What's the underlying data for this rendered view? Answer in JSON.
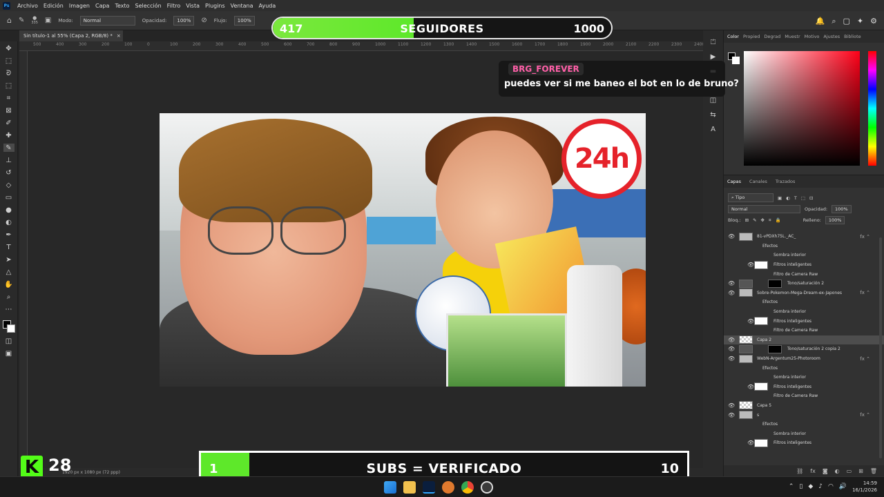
{
  "app": {
    "logo": "Ps",
    "menu": [
      "Archivo",
      "Edición",
      "Imagen",
      "Capa",
      "Texto",
      "Selección",
      "Filtro",
      "Vista",
      "Plugins",
      "Ventana",
      "Ayuda"
    ]
  },
  "options_bar": {
    "brush_size": "335",
    "mode_label": "Modo:",
    "mode_value": "Normal",
    "opacity_label": "Opacidad:",
    "opacity_value": "100%",
    "flow_label": "Flujo:",
    "flow_value": "100%"
  },
  "document_tab": {
    "title": "Sin título-1 al 55% (Capa 2, RGB/8) *",
    "close": "×"
  },
  "ruler_ticks": [
    "500",
    "400",
    "300",
    "200",
    "100",
    "0",
    "100",
    "200",
    "300",
    "400",
    "500",
    "600",
    "700",
    "800",
    "900",
    "1000",
    "1100",
    "1200",
    "1300",
    "1400",
    "1500",
    "1600",
    "1700",
    "1800",
    "1900",
    "2000",
    "2100",
    "2200",
    "2300",
    "2400"
  ],
  "thumbnail": {
    "badge_text": "24h",
    "badge_color": "#e5222a"
  },
  "status_bar": {
    "dimensions": "1920 px x 1080 px (72 ppp)"
  },
  "color_panel": {
    "tabs": [
      "Color",
      "Propied",
      "Degrad",
      "Muestr",
      "Motivo",
      "Ajustes",
      "Bibliote"
    ]
  },
  "layers_panel": {
    "tabs": [
      "Capas",
      "Canales",
      "Trazados"
    ],
    "filter_type": "Tipo",
    "blend_mode": "Normal",
    "opacity_label": "Opacidad:",
    "opacity_value": "100%",
    "lock_label": "Bloq.:",
    "fill_label": "Relleno:",
    "fill_value": "100%",
    "layers": [
      {
        "name": "81-vPDXh75L._AC_",
        "kind": "smart",
        "fx": true
      },
      {
        "name": "Efectos",
        "kind": "sub"
      },
      {
        "name": "Sombra interior",
        "kind": "sub2"
      },
      {
        "name": "Filtros inteligentes",
        "kind": "sub2w"
      },
      {
        "name": "Filtro de Camera Raw",
        "kind": "sub2"
      },
      {
        "name": "Tono/saturación 2",
        "kind": "adjust"
      },
      {
        "name": "Sobre-Pokemon-Mega-Dream-ex-Japones",
        "kind": "smart",
        "fx": true
      },
      {
        "name": "Efectos",
        "kind": "sub"
      },
      {
        "name": "Sombra interior",
        "kind": "sub2"
      },
      {
        "name": "Filtros inteligentes",
        "kind": "sub2w"
      },
      {
        "name": "Filtro de Camera Raw",
        "kind": "sub2"
      },
      {
        "name": "Capa 2",
        "kind": "pixel",
        "selected": true
      },
      {
        "name": "Tono/saturación 2 copia 2",
        "kind": "adjust"
      },
      {
        "name": "WebN-Argentum25-Photoroom",
        "kind": "smart",
        "fx": true
      },
      {
        "name": "Efectos",
        "kind": "sub"
      },
      {
        "name": "Sombra interior",
        "kind": "sub2"
      },
      {
        "name": "Filtros inteligentes",
        "kind": "sub2w"
      },
      {
        "name": "Filtro de Camera Raw",
        "kind": "sub2"
      },
      {
        "name": "Capa 5",
        "kind": "pixel"
      },
      {
        "name": "s",
        "kind": "smart",
        "fx": true
      },
      {
        "name": "Efectos",
        "kind": "sub"
      },
      {
        "name": "Sombra interior",
        "kind": "sub2"
      },
      {
        "name": "Filtros inteligentes",
        "kind": "sub2w"
      }
    ]
  },
  "overlay_followers": {
    "current": "417",
    "label": "SEGUIDORES",
    "goal": "1000",
    "progress": 0.417,
    "color": "#5ee82a"
  },
  "overlay_chat": {
    "username": "BRG_FOREVER",
    "message": "puedes ver si me baneo el bot en lo de bruno?",
    "user_color": "#ff5fa8"
  },
  "overlay_kick": {
    "logo": "K",
    "count": "28",
    "color": "#53fc18"
  },
  "overlay_subs": {
    "current": "1",
    "label": "SUBS = VERIFICADO",
    "goal": "10",
    "progress": 0.1
  },
  "taskbar": {
    "time": "14:59",
    "date": "16/1/2026"
  }
}
